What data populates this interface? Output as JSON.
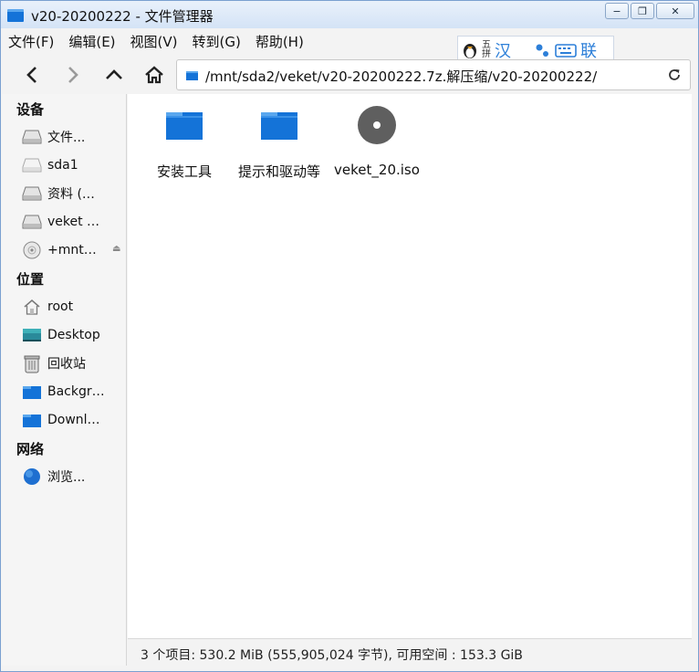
{
  "window": {
    "title": "v20-20200222 - 文件管理器",
    "minimize_glyph": "−",
    "maximize_glyph": "❐",
    "close_glyph": "✕"
  },
  "menu": [
    "文件(F)",
    "编辑(E)",
    "视图(V)",
    "转到(G)",
    "帮助(H)"
  ],
  "ime": {
    "line1": "五",
    "line2": "拼",
    "mode": "汉",
    "label": "联"
  },
  "toolbar": {
    "back_icon": "chevron-left-icon",
    "forward_icon": "chevron-right-icon",
    "up_icon": "chevron-up-icon",
    "home_icon": "home-icon",
    "path": "/mnt/sda2/veket/v20-20200222.7z.解压缩/v20-20200222/",
    "reload_icon": "reload-icon"
  },
  "sidebar": {
    "devices_title": "设备",
    "devices": [
      "文件...",
      "sda1",
      "资料 (…",
      "veket …",
      "+mnt…"
    ],
    "places_title": "位置",
    "places": [
      "root",
      "Desktop",
      "回收站",
      "Backgr…",
      "Downl…"
    ],
    "network_title": "网络",
    "network": [
      "浏览..."
    ]
  },
  "files": [
    {
      "name": "安装工具",
      "type": "folder"
    },
    {
      "name": "提示和驱动等",
      "type": "folder"
    },
    {
      "name": "veket_20.iso",
      "type": "disc"
    }
  ],
  "status": "3 个项目: 530.2 MiB (555,905,024 字节), 可用空间 : 153.3 GiB",
  "colors": {
    "folder": "#1473d8",
    "folder_tab": "#5aa7ee",
    "disc": "#5f5f5f"
  }
}
